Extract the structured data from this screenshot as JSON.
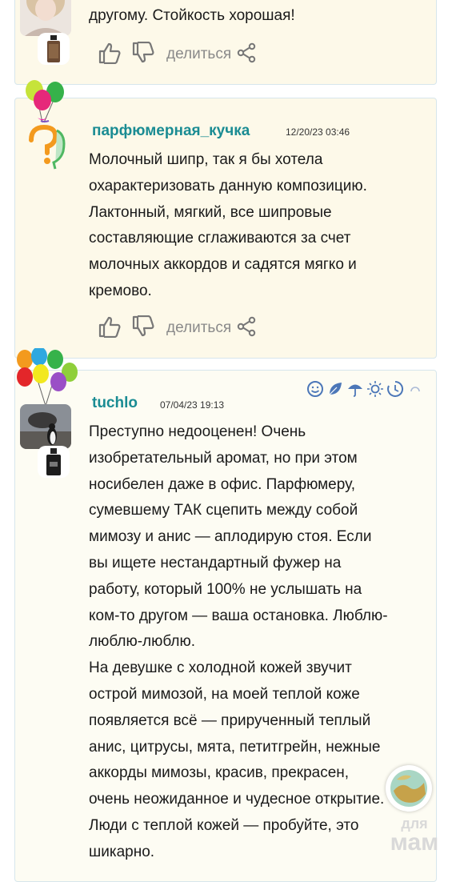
{
  "comments": [
    {
      "text": "другому. Стойкость хорошая!",
      "actions": {
        "share_label": "делиться"
      }
    },
    {
      "username": "парфюмерная_кучка",
      "date": "12/20/23 03:46",
      "text": "Молочный шипр, так я бы хотела\nохарактеризовать данную композицию.\nЛактонный, мягкий, все шипровые\nсоставляющие сглаживаются за счет\nмолочных аккордов и садятся мягко и\nкремово.",
      "actions": {
        "share_label": "делиться"
      }
    },
    {
      "username": "tuchlo",
      "date": "07/04/23 19:13",
      "text": "Преступно недооценен! Очень\nизобретательный аромат, но при этом\nносибелен даже в офис. Парфюмеру,\nсумевшему ТАК сцепить между собой\nмимозу и анис — аплодирую стоя. Если\nвы ищете нестандартный фужер на\nработу, который 100% не услышать на\nком-то другом — ваша остановка. Люблю-\nлюблю-люблю.\nНа девушке с холодной кожей звучит\nострой мимозой, на моей теплой коже\nпоявляется всё — прирученный теплый\nанис, цитрусы, мята, петитгрейн, нежные\nаккорды мимозы, красив, прекрасен,\nочень неожиданное и чудесное открытие.\nЛюди с теплой кожей — пробуйте, это\nшикарно."
    }
  ],
  "watermark": {
    "line1": "для",
    "line2": "мам"
  },
  "colors": {
    "username": "#1a8c93",
    "card_border": "#d7e6ec",
    "card_bg": "#fdf9e9",
    "muted": "#8a8a8a"
  }
}
